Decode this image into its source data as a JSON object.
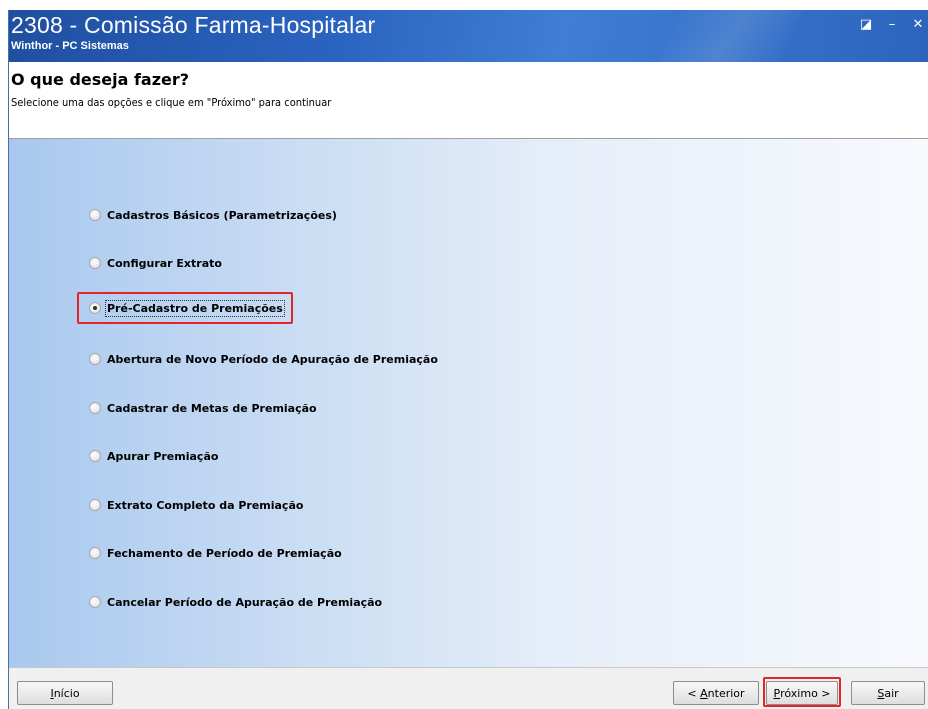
{
  "window": {
    "title": "2308 - Comissão Farma-Hospitalar",
    "subtitle": "Winthor - PC Sistemas",
    "controls": {
      "restore": "◪",
      "minimize": "–",
      "close": "✕"
    }
  },
  "header": {
    "title": "O que deseja fazer?",
    "subtitle": "Selecione uma das opções e clique em \"Próximo\" para continuar"
  },
  "options": [
    {
      "label": "Cadastros Básicos (Parametrizações)",
      "checked": false
    },
    {
      "label": "Configurar Extrato",
      "checked": false
    },
    {
      "label": "Pré-Cadastro de Premiações",
      "checked": true
    },
    {
      "label": "Abertura de Novo Período de Apuração de Premiação",
      "checked": false
    },
    {
      "label": "Cadastrar de Metas de Premiação",
      "checked": false
    },
    {
      "label": "Apurar Premiação",
      "checked": false
    },
    {
      "label": "Extrato Completo da Premiação",
      "checked": false
    },
    {
      "label": "Fechamento de Período de Premiação",
      "checked": false
    },
    {
      "label": "Cancelar Período de Apuração de  Premiação",
      "checked": false
    }
  ],
  "footer": {
    "inicio": {
      "mnemonic": "I",
      "rest": "nício"
    },
    "anterior": {
      "prefix": "< ",
      "mnemonic": "A",
      "rest": "nterior"
    },
    "proximo": {
      "mnemonic": "P",
      "rest": "róximo >"
    },
    "sair": {
      "mnemonic": "S",
      "rest": "air"
    }
  },
  "colors": {
    "highlight": "#e0262a",
    "titlebar": "#2a63bf"
  }
}
